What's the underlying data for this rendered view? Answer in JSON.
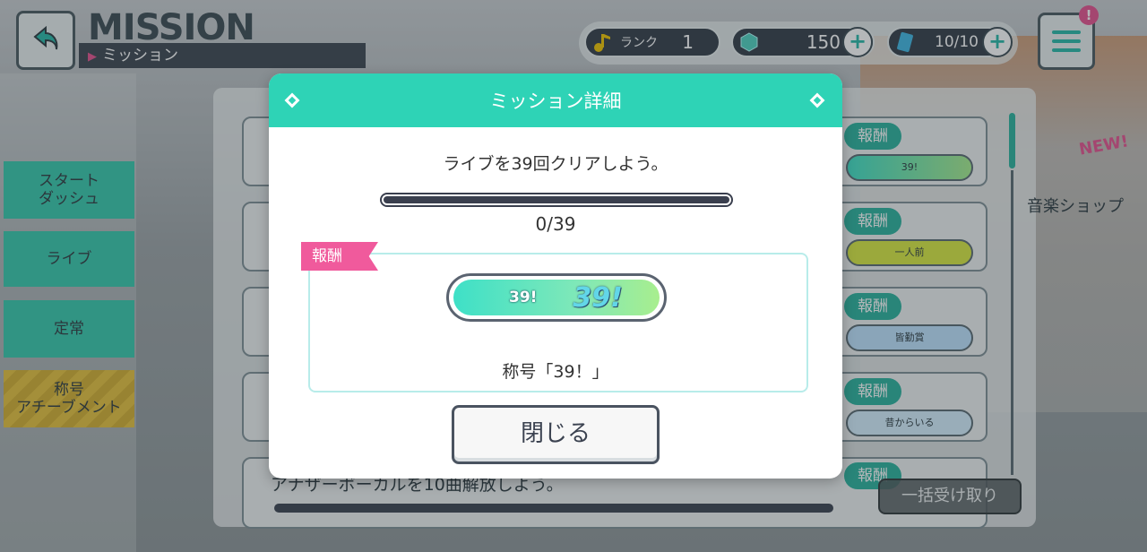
{
  "header": {
    "title": "MISSION",
    "subtitle": "ミッション",
    "rank_label": "ランク",
    "rank_value": "1",
    "gems": "150",
    "tickets": "10/10",
    "badge": "!"
  },
  "sidebar": {
    "items": [
      {
        "label": "スタート\nダッシュ"
      },
      {
        "label": "ライブ"
      },
      {
        "label": "定常"
      },
      {
        "label": "称号\nアチーブメント"
      }
    ]
  },
  "list": {
    "reward_tag": "報酬",
    "item_rewards": [
      "39!",
      "一人前",
      "皆勤賞",
      "昔からいる"
    ],
    "last_item_text": "アナザーボーカルを10曲解放しよう。",
    "collect_all": "一括受け取り",
    "shop_label": "音楽ショップ",
    "new_label": "NEW!"
  },
  "modal": {
    "title": "ミッション詳細",
    "description": "ライブを39回クリアしよう。",
    "progress_current": 0,
    "progress_total": 39,
    "progress_text": "0/39",
    "reward_label": "報酬",
    "reward_pill_text": "39!",
    "reward_pill_logo": "39!",
    "reward_name": "称号「39！」",
    "close_label": "閉じる"
  },
  "colors": {
    "accent_teal": "#2ed3b6",
    "reward_pink": "#f05a9c",
    "dark_navy": "#3a3f4e"
  }
}
